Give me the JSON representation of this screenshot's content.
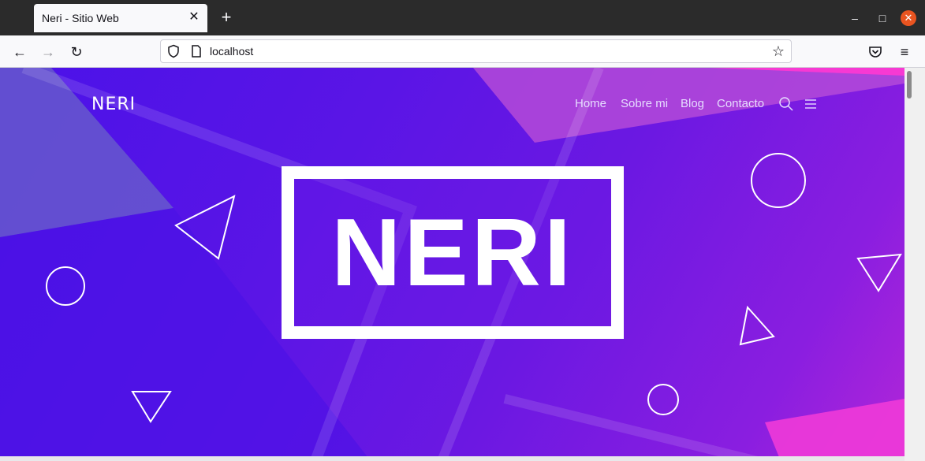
{
  "browser": {
    "tab_title": "Neri - Sitio Web",
    "tab_close": "✕",
    "new_tab": "+",
    "url": "localhost",
    "win_min": "–",
    "win_max": "□",
    "win_close": "✕",
    "back": "←",
    "forward": "→",
    "reload": "↻",
    "bookmark": "☆",
    "menu": "≡"
  },
  "site": {
    "brand": "NERI",
    "nav": [
      "Home",
      "Sobre mi",
      "Blog",
      "Contacto"
    ],
    "logo": "NERI"
  },
  "icons": {
    "search": "search-icon",
    "hamburger": "hamburger-menu-icon",
    "shield": "shield-icon",
    "page": "page-icon",
    "pocket": "pocket-icon"
  },
  "colors": {
    "hero_start": "#4b12e8",
    "hero_end": "#b226d8",
    "accent_pink": "#ff2fd0",
    "window_close": "#e95420"
  }
}
